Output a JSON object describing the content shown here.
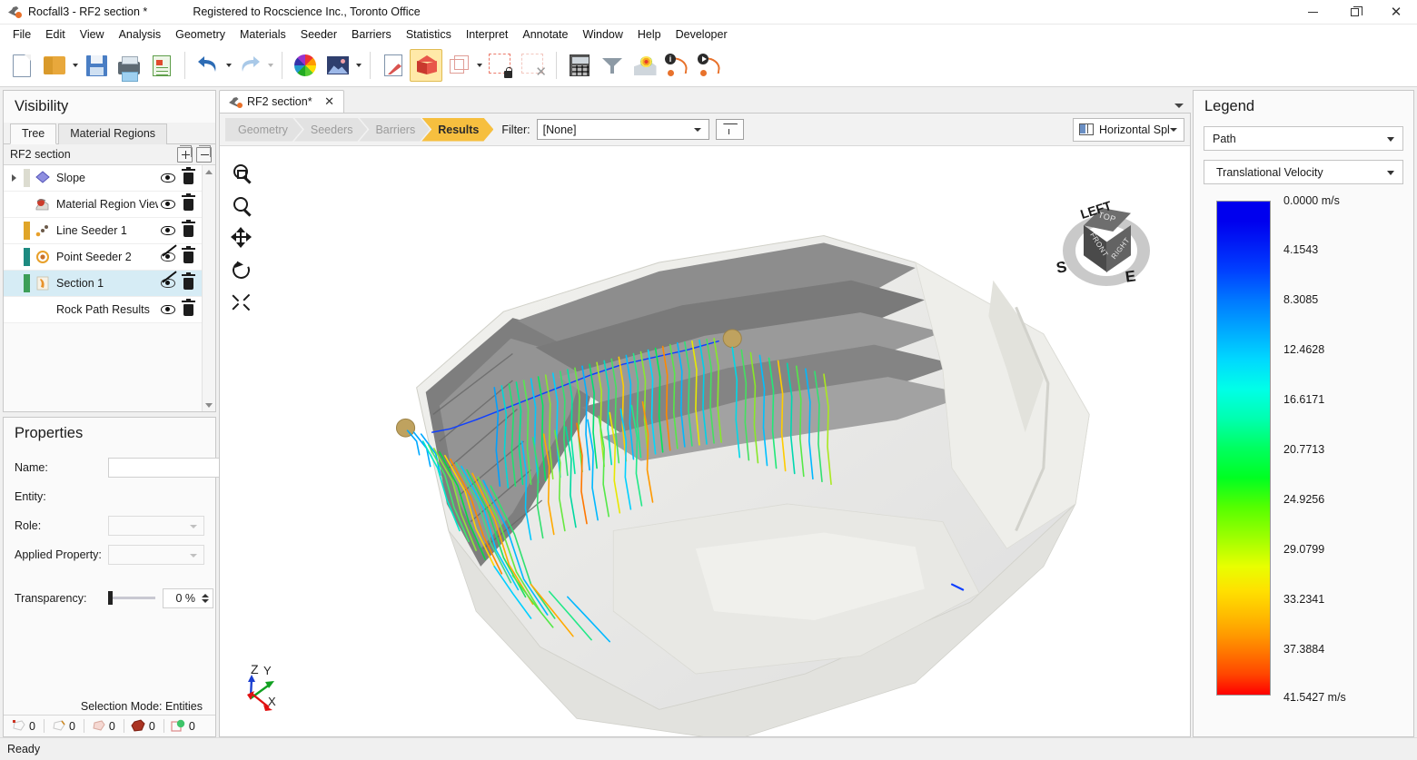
{
  "window": {
    "app_title": "Rocfall3 - RF2 section *",
    "registration": "Registered to Rocscience Inc., Toronto Office",
    "minimize_label": "Minimize",
    "restore_label": "Restore",
    "close_label": "Close"
  },
  "menu": [
    {
      "label": "File",
      "accel": "F"
    },
    {
      "label": "Edit",
      "accel": "E"
    },
    {
      "label": "View",
      "accel": "V"
    },
    {
      "label": "Analysis",
      "accel": ""
    },
    {
      "label": "Geometry",
      "accel": "G"
    },
    {
      "label": "Materials",
      "accel": "t"
    },
    {
      "label": "Seeder",
      "accel": ""
    },
    {
      "label": "Barriers",
      "accel": "B"
    },
    {
      "label": "Statistics",
      "accel": "S"
    },
    {
      "label": "Interpret",
      "accel": "I"
    },
    {
      "label": "Annotate",
      "accel": "A"
    },
    {
      "label": "Window",
      "accel": "W"
    },
    {
      "label": "Help",
      "accel": "H"
    },
    {
      "label": "Developer",
      "accel": "e"
    }
  ],
  "toolbar": {
    "new_label": "New",
    "open_label": "Open",
    "save_label": "Save",
    "print_label": "Print",
    "report_label": "Report Generator",
    "undo_label": "Undo",
    "redo_label": "Redo",
    "colors_label": "Display Options",
    "image_label": "Image Export",
    "plandoc_label": "Edit Geometry",
    "solid_label": "Solid View",
    "wireframe_label": "Wireframe View",
    "select_lock_label": "Selection Lock",
    "select_clear_label": "Clear Selection",
    "compute_label": "Compute",
    "filter_label": "Filter",
    "contour_label": "Contour Results",
    "path_info_label": "Path Info",
    "path_animate_label": "Animate Path"
  },
  "visibility": {
    "title": "Visibility",
    "tabs": [
      {
        "label": "Tree",
        "active": true
      },
      {
        "label": "Material Regions",
        "active": false
      }
    ],
    "tree_header": "RF2 section",
    "expand_all_label": "Expand All",
    "collapse_all_label": "Collapse All",
    "items": [
      {
        "label": "Slope",
        "icon": "slope-icon",
        "swatch": "#dcdcd0",
        "visible": true,
        "selected": false,
        "expandable": true,
        "indent": 0
      },
      {
        "label": "Material Region View",
        "icon": "material-region-icon",
        "swatch": "",
        "visible": true,
        "selected": false,
        "expandable": false,
        "indent": 1
      },
      {
        "label": "Line Seeder 1",
        "icon": "line-seeder-icon",
        "swatch": "#e0a528",
        "visible": true,
        "selected": false,
        "expandable": false,
        "indent": 1
      },
      {
        "label": "Point Seeder 2",
        "icon": "point-seeder-icon",
        "swatch": "#1d8a80",
        "visible": false,
        "selected": false,
        "expandable": false,
        "indent": 1
      },
      {
        "label": "Section 1",
        "icon": "section-icon",
        "swatch": "#3d9e58",
        "visible": false,
        "selected": true,
        "expandable": false,
        "indent": 1
      },
      {
        "label": "Rock Path Results",
        "icon": "",
        "swatch": "",
        "visible": true,
        "selected": false,
        "expandable": false,
        "indent": 2
      }
    ]
  },
  "properties": {
    "title": "Properties",
    "name_label": "Name:",
    "name_value": "",
    "entity_label": "Entity:",
    "entity_value": "",
    "role_label": "Role:",
    "role_value": "",
    "applied_property_label": "Applied Property:",
    "applied_property_value": "",
    "transparency_label": "Transparency:",
    "transparency_value": "0 %",
    "selection_mode_label": "Selection Mode:",
    "selection_mode_value": "Entities",
    "counters": [
      {
        "name": "vertex-count",
        "value": "0"
      },
      {
        "name": "edge-count",
        "value": "0"
      },
      {
        "name": "face-count",
        "value": "0"
      },
      {
        "name": "solid-count",
        "value": "0"
      },
      {
        "name": "group-count",
        "value": "0"
      }
    ]
  },
  "document": {
    "tab_label": "RF2 section*",
    "close_label": "✕"
  },
  "workflow": {
    "steps": [
      {
        "label": "Geometry",
        "active": false
      },
      {
        "label": "Seeders",
        "active": false
      },
      {
        "label": "Barriers",
        "active": false
      },
      {
        "label": "Results",
        "active": true
      }
    ],
    "filter_label": "Filter:",
    "filter_value": "[None]",
    "filter_button_label": "Apply Filter",
    "split_value": "Horizontal Spl"
  },
  "viewport_tools": [
    {
      "name": "zoom-window-tool",
      "label": "Zoom Window"
    },
    {
      "name": "zoom-tool",
      "label": "Zoom"
    },
    {
      "name": "pan-tool",
      "label": "Pan"
    },
    {
      "name": "rotate-tool",
      "label": "Rotate"
    },
    {
      "name": "zoom-all-tool",
      "label": "Zoom All"
    }
  ],
  "viewcube": {
    "top_label": "TOP",
    "left_label": "LEFT",
    "front_label": "FRONT",
    "right_label": "RIGHT",
    "compass_south": "S",
    "compass_east": "E"
  },
  "axes": {
    "x_label": "X",
    "y_label": "Y",
    "z_label": "Z"
  },
  "legend": {
    "title": "Legend",
    "mode_value": "Path",
    "quantity_value": "Translational Velocity",
    "unit": "m/s",
    "ticks": [
      {
        "value": "0.0000 m/s",
        "pos_pct": 0
      },
      {
        "value": "4.1543",
        "pos_pct": 10
      },
      {
        "value": "8.3085",
        "pos_pct": 20
      },
      {
        "value": "12.4628",
        "pos_pct": 30
      },
      {
        "value": "16.6171",
        "pos_pct": 40
      },
      {
        "value": "20.7713",
        "pos_pct": 50
      },
      {
        "value": "24.9256",
        "pos_pct": 60
      },
      {
        "value": "29.0799",
        "pos_pct": 70
      },
      {
        "value": "33.2341",
        "pos_pct": 80
      },
      {
        "value": "37.3884",
        "pos_pct": 90
      },
      {
        "value": "41.5427 m/s",
        "pos_pct": 100
      }
    ],
    "colors": {
      "min": "#0000ee",
      "low": "#00a8ff",
      "mid_low": "#00ffe8",
      "mid": "#00ff22",
      "mid_high": "#e8ff00",
      "high": "#ff9900",
      "max": "#ff0000"
    }
  },
  "status": {
    "message": "Ready"
  }
}
